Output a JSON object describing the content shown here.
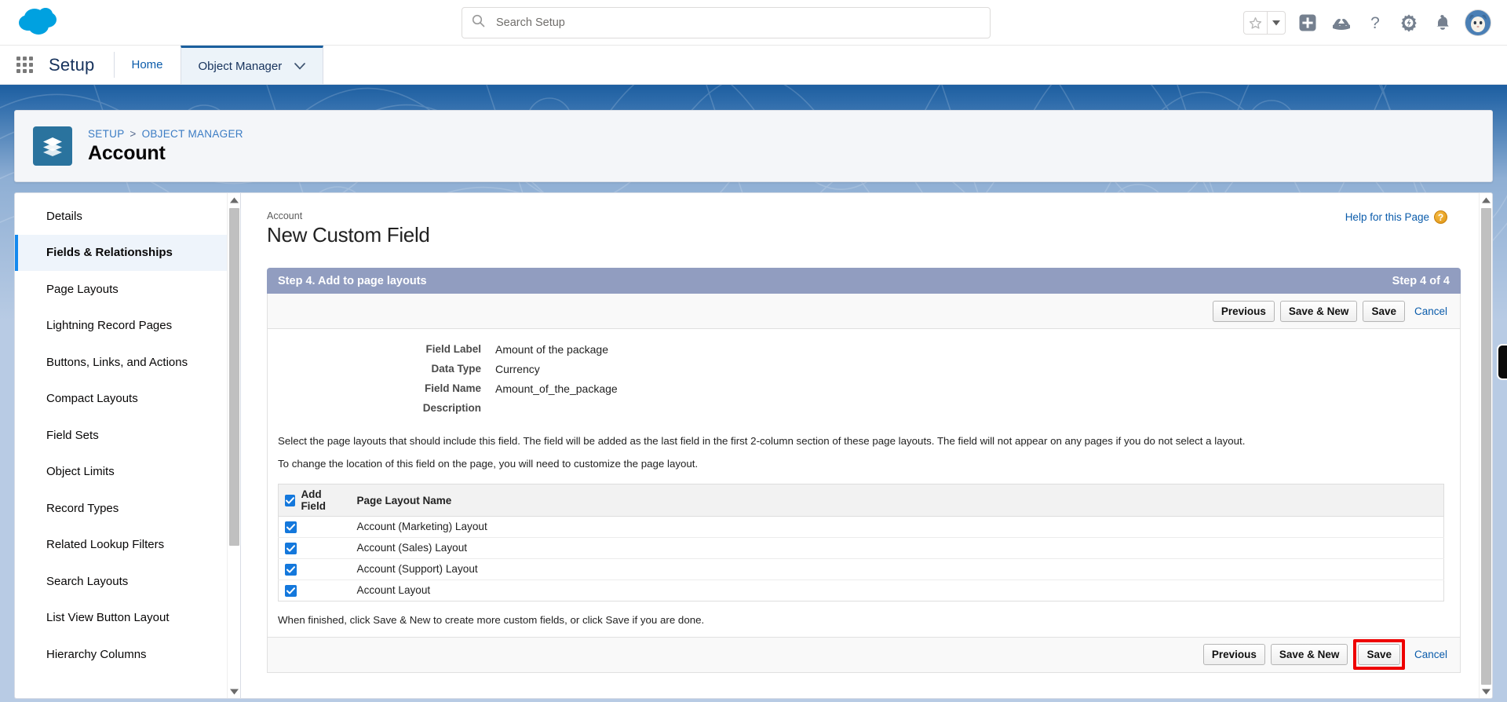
{
  "header": {
    "logo_name": "salesforce-cloud-logo",
    "search": {
      "placeholder": "Search Setup",
      "value": "",
      "icon": "search-icon"
    },
    "icons": [
      {
        "name": "favorites-star-icon",
        "glyph": "star"
      },
      {
        "name": "favorites-dropdown-icon",
        "glyph": "caret-down"
      },
      {
        "name": "global-add-icon",
        "glyph": "plus-square"
      },
      {
        "name": "einstein-icon",
        "glyph": "cloud-mountain"
      },
      {
        "name": "help-icon",
        "glyph": "question-mark"
      },
      {
        "name": "setup-gear-icon",
        "glyph": "gear"
      },
      {
        "name": "notifications-bell-icon",
        "glyph": "bell"
      },
      {
        "name": "user-avatar",
        "glyph": "avatar"
      }
    ]
  },
  "setup_nav": {
    "app_launcher": "app-launcher-waffle-icon",
    "title": "Setup",
    "tabs": [
      {
        "label": "Home",
        "active": false,
        "has_caret": false
      },
      {
        "label": "Object Manager",
        "active": true,
        "has_caret": true
      }
    ]
  },
  "object_header": {
    "breadcrumb": {
      "root": "SETUP",
      "separator": ">",
      "parent": "OBJECT MANAGER"
    },
    "object_name": "Account",
    "icon": "layers-stack-icon"
  },
  "sidebar": {
    "items": [
      {
        "label": "Details",
        "active": false
      },
      {
        "label": "Fields & Relationships",
        "active": true
      },
      {
        "label": "Page Layouts",
        "active": false
      },
      {
        "label": "Lightning Record Pages",
        "active": false
      },
      {
        "label": "Buttons, Links, and Actions",
        "active": false
      },
      {
        "label": "Compact Layouts",
        "active": false
      },
      {
        "label": "Field Sets",
        "active": false
      },
      {
        "label": "Object Limits",
        "active": false
      },
      {
        "label": "Record Types",
        "active": false
      },
      {
        "label": "Related Lookup Filters",
        "active": false
      },
      {
        "label": "Search Layouts",
        "active": false
      },
      {
        "label": "List View Button Layout",
        "active": false
      },
      {
        "label": "Hierarchy Columns",
        "active": false
      }
    ]
  },
  "main": {
    "context_label": "Account",
    "page_title": "New Custom Field",
    "help_link": "Help for this Page",
    "step_band": {
      "title": "Step 4. Add to page layouts",
      "step_counter": "Step 4 of 4"
    },
    "buttons": {
      "previous": "Previous",
      "save_and_new": "Save & New",
      "save": "Save",
      "cancel": "Cancel"
    },
    "field_summary": [
      {
        "label": "Field Label",
        "value": "Amount of the package"
      },
      {
        "label": "Data Type",
        "value": "Currency"
      },
      {
        "label": "Field Name",
        "value": "Amount_of_the_package"
      },
      {
        "label": "Description",
        "value": ""
      }
    ],
    "instructions": {
      "paragraph_1": "Select the page layouts that should include this field. The field will be added as the last field in the first 2-column section of these page layouts. The field will not appear on any pages if you do not select a layout.",
      "paragraph_2": "To change the location of this field on the page, you will need to customize the page layout.",
      "footer_note": "When finished, click Save & New to create more custom fields, or click Save if you are done."
    },
    "layout_table": {
      "columns": [
        "Add Field",
        "Page Layout Name"
      ],
      "header_checkbox_checked": true,
      "rows": [
        {
          "checked": true,
          "name": "Account (Marketing) Layout"
        },
        {
          "checked": true,
          "name": "Account (Sales) Layout"
        },
        {
          "checked": true,
          "name": "Account (Support) Layout"
        },
        {
          "checked": true,
          "name": "Account Layout"
        }
      ]
    },
    "highlight": {
      "target": "save-button-bottom",
      "color": "#ee0000"
    }
  },
  "colors": {
    "brand_blue": "#1589ee",
    "header_band": "#919dc0",
    "link": "#0b5cab",
    "checkbox": "#1478dc",
    "highlight_red": "#ee0000",
    "page_bg": "#b8cbe4"
  }
}
